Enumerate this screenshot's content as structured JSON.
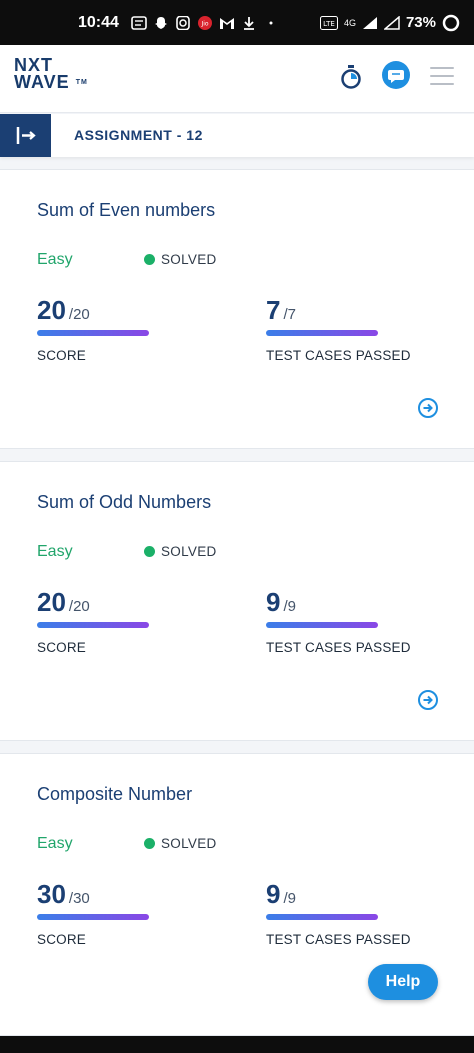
{
  "status_bar": {
    "time": "10:44",
    "network": "4G",
    "battery": "73%"
  },
  "header": {
    "logo_line1": "NXT",
    "logo_line2": "WAVE",
    "logo_tm": "TM"
  },
  "assignment": {
    "title": "ASSIGNMENT - 12"
  },
  "colors": {
    "brand_navy": "#1b3f73",
    "accent_blue": "#1e8fe0",
    "easy_green": "#21a56b",
    "solved_dot": "#1bb068"
  },
  "problems": [
    {
      "title": "Sum of Even numbers",
      "difficulty": "Easy",
      "status": "SOLVED",
      "score": "20",
      "score_total": "/20",
      "score_label": "SCORE",
      "tests": "7",
      "tests_total": "/7",
      "tests_label": "TEST CASES PASSED"
    },
    {
      "title": "Sum of Odd Numbers",
      "difficulty": "Easy",
      "status": "SOLVED",
      "score": "20",
      "score_total": "/20",
      "score_label": "SCORE",
      "tests": "9",
      "tests_total": "/9",
      "tests_label": "TEST CASES PASSED"
    },
    {
      "title": "Composite Number",
      "difficulty": "Easy",
      "status": "SOLVED",
      "score": "30",
      "score_total": "/30",
      "score_label": "SCORE",
      "tests": "9",
      "tests_total": "/9",
      "tests_label": "TEST CASES PASSED"
    }
  ],
  "help_button": {
    "label": "Help"
  }
}
